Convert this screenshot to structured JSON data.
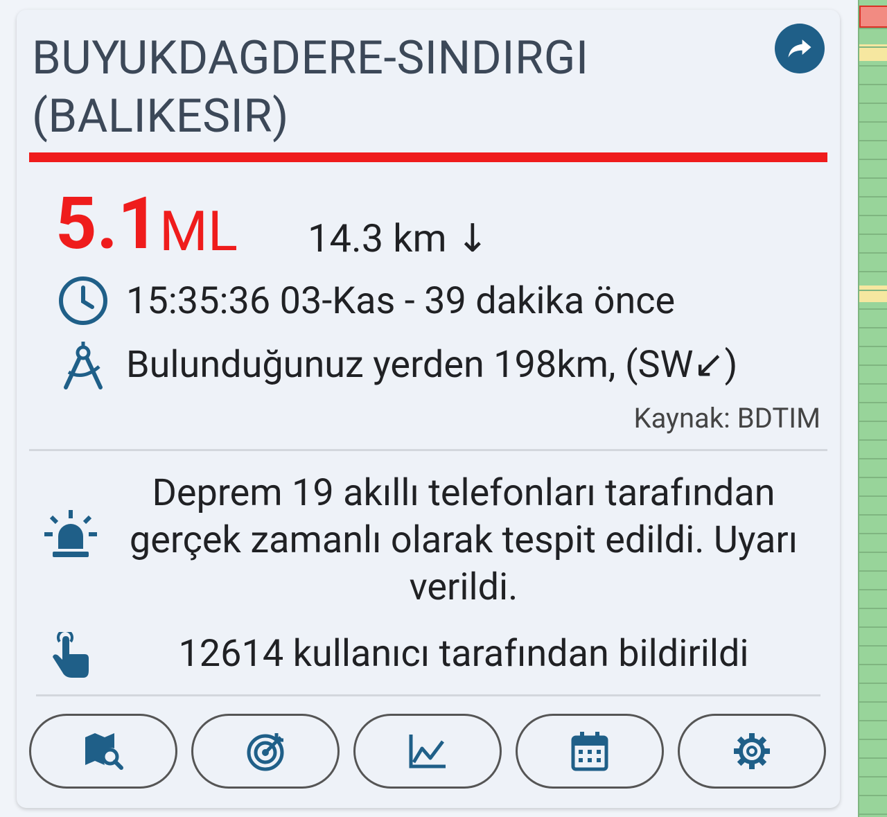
{
  "event": {
    "title": "BUYUKDAGDERE-SINDIRGI (BALIKESIR)",
    "magnitude": "5.1",
    "magnitude_unit": "ML",
    "depth": "14.3 km ↓",
    "time": "15:35:36 03-Kas - 39 dakika önce",
    "distance": "Bulunduğunuz yerden 198km, (SW↙)",
    "source": "Kaynak: BDTIM",
    "detection": "Deprem 19 akıllı telefonları tarafından gerçek zamanlı olarak tespit edildi. Uyarı verildi.",
    "reports": "12614 kullanıcı tarafından bildirildi"
  },
  "colors": {
    "accent": "#ef1c1c",
    "icon": "#1f5f88",
    "text": "#202124"
  },
  "actions": [
    {
      "icon": "map-search-icon"
    },
    {
      "icon": "target-icon"
    },
    {
      "icon": "chart-line-icon"
    },
    {
      "icon": "calendar-icon"
    },
    {
      "icon": "gear-icon"
    }
  ]
}
